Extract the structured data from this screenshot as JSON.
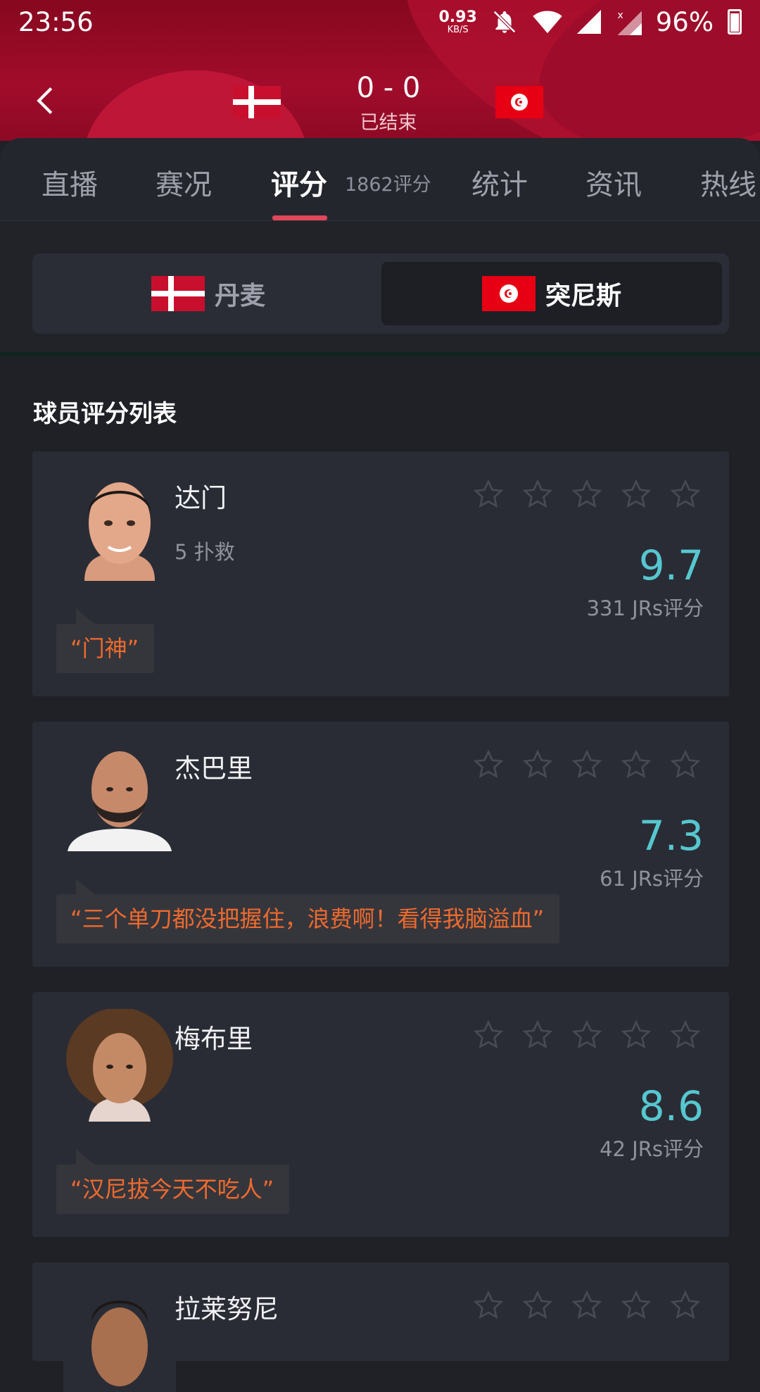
{
  "status_bar": {
    "time": "23:56",
    "net_speed": "0.93",
    "net_unit": "KB/S",
    "battery": "96%"
  },
  "match": {
    "score": "0 - 0",
    "status": "已结束"
  },
  "tabs": [
    {
      "label": "直播"
    },
    {
      "label": "赛况"
    },
    {
      "label": "评分"
    },
    {
      "label": "统计"
    },
    {
      "label": "资讯"
    },
    {
      "label": "热线"
    }
  ],
  "rating_count": "1862评分",
  "teams": {
    "home": "丹麦",
    "away": "突尼斯",
    "selected": "突尼斯"
  },
  "section_title": "球员评分列表",
  "players": [
    {
      "name": "达门",
      "stat": "5 扑救",
      "rating": "9.7",
      "votes": "331 JRs评分",
      "comment": "“门神”"
    },
    {
      "name": "杰巴里",
      "stat": "",
      "rating": "7.3",
      "votes": "61 JRs评分",
      "comment": "“三个单刀都没把握住，浪费啊！看得我脑溢血”"
    },
    {
      "name": "梅布里",
      "stat": "",
      "rating": "8.6",
      "votes": "42 JRs评分",
      "comment": "“汉尼拔今天不吃人”"
    },
    {
      "name": "拉莱努尼",
      "stat": "",
      "rating": "",
      "votes": "",
      "comment": ""
    }
  ],
  "colors": {
    "header_red": "#a10c2b",
    "accent_teal": "#56c7cf",
    "comment_orange": "#ee6a2e",
    "tab_indicator": "#e0475a"
  }
}
